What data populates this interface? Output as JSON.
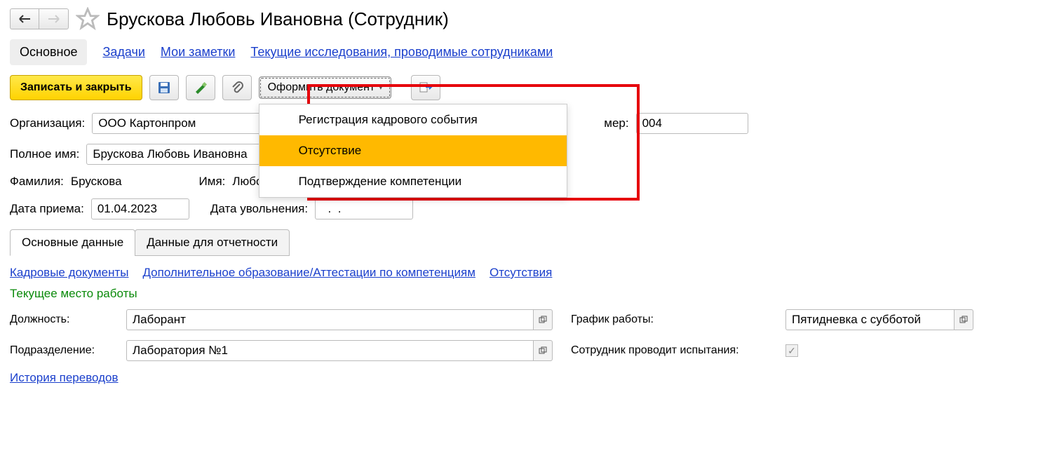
{
  "header": {
    "title": "Брускова Любовь Ивановна (Сотрудник)"
  },
  "navTabs": {
    "main": "Основное",
    "tasks": "Задачи",
    "notes": "Мои заметки",
    "research": "Текущие исследования, проводимые сотрудниками"
  },
  "toolbar": {
    "saveClose": "Записать и закрыть",
    "createDoc": "Оформить документ",
    "menu": {
      "item1": "Регистрация кадрового события",
      "item2": "Отсутствие",
      "item3": "Подтверждение компетенции"
    }
  },
  "fields": {
    "orgLabel": "Организация:",
    "orgValue": "ООО Картонпром",
    "numberLabel": "мер:",
    "numberValue": "004",
    "fullNameLabel": "Полное имя:",
    "fullNameValue": "Брускова Любовь Ивановна",
    "surnameLabel": "Фамилия:",
    "surnameValue": "Брускова",
    "nameLabel": "Имя:",
    "nameValue": "Любовь",
    "hireDateLabel": "Дата приема:",
    "hireDateValue": "01.04.2023",
    "fireDateLabel": "Дата увольнения:",
    "fireDateValue": "  .  .    "
  },
  "tabs2": {
    "main": "Основные данные",
    "report": "Данные для отчетности"
  },
  "links": {
    "hrDocs": "Кадровые документы",
    "education": "Дополнительное образование/Аттестации по компетенциям",
    "absence": "Отсутствия"
  },
  "section": {
    "currentJob": "Текущее место работы",
    "positionLabel": "Должность:",
    "positionValue": "Лаборант",
    "scheduleLabel": "График работы:",
    "scheduleValue": "Пятидневка с субботой",
    "deptLabel": "Подразделение:",
    "deptValue": "Лаборатория №1",
    "conductsLabel": "Сотрудник проводит испытания:",
    "historyLink": "История переводов"
  }
}
